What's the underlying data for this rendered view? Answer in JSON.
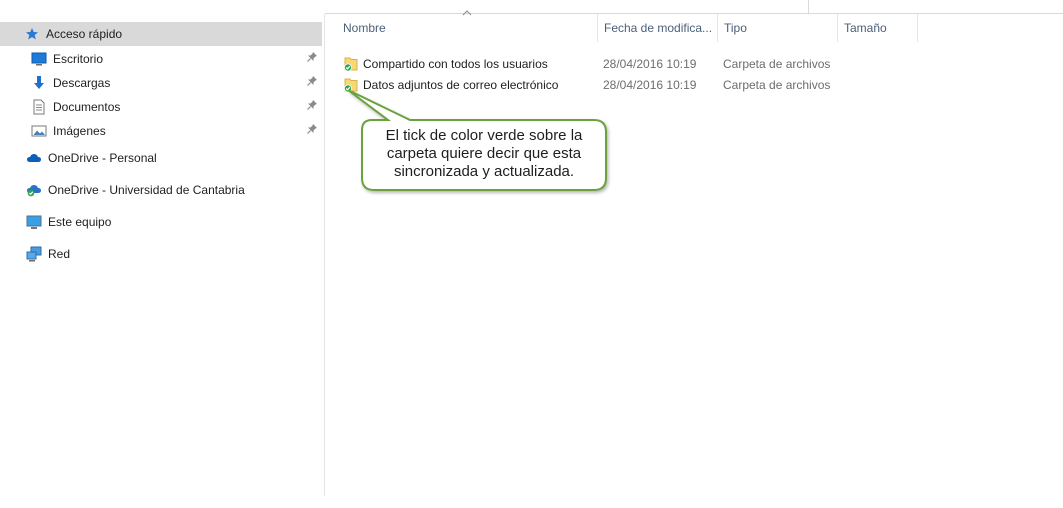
{
  "nav": {
    "items": [
      {
        "label": "Acceso rápido",
        "icon": "star-icon",
        "pinned": false,
        "selected": true
      },
      {
        "label": "Escritorio",
        "icon": "desktop-icon",
        "pinned": true
      },
      {
        "label": "Descargas",
        "icon": "download-icon",
        "pinned": true
      },
      {
        "label": "Documentos",
        "icon": "documents-icon",
        "pinned": true
      },
      {
        "label": "Imágenes",
        "icon": "pictures-icon",
        "pinned": true
      },
      {
        "label": "OneDrive - Personal",
        "icon": "onedrive-icon"
      },
      {
        "label": "OneDrive - Universidad de Cantabria",
        "icon": "onedrive-business-icon"
      },
      {
        "label": "Este equipo",
        "icon": "computer-icon"
      },
      {
        "label": "Red",
        "icon": "network-icon"
      }
    ]
  },
  "columns": {
    "name": "Nombre",
    "date": "Fecha de modifica...",
    "type": "Tipo",
    "size": "Tamaño"
  },
  "files": [
    {
      "name": "Compartido con todos los usuarios",
      "date": "28/04/2016 10:19",
      "type": "Carpeta de archivos",
      "status": "synced-check-icon"
    },
    {
      "name": "Datos adjuntos de correo electrónico",
      "date": "28/04/2016 10:19",
      "type": "Carpeta de archivos",
      "status": "synced-check-icon"
    }
  ],
  "callout": {
    "line1": "El tick de color verde sobre la",
    "line2": "carpeta quiere decir que esta",
    "line3": "sincronizada y actualizada."
  },
  "colors": {
    "selection": "#d9d9d9",
    "header_text": "#4c607a",
    "callout_border": "#6aa33a",
    "sync_green": "#2da44e",
    "folder_yellow": "#f8d775"
  }
}
